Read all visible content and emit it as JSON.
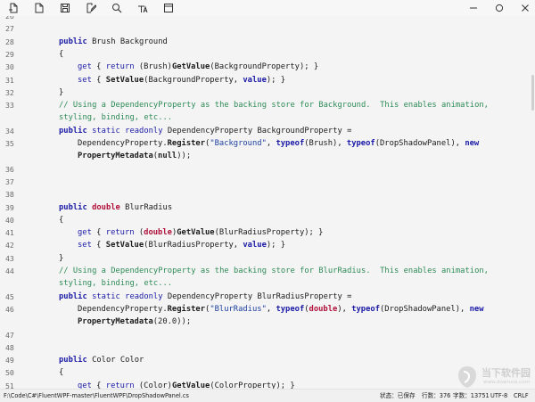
{
  "toolbar": {
    "icons": [
      "new-file-icon",
      "open-file-icon",
      "save-icon",
      "edit-icon",
      "search-icon",
      "format-icon",
      "panel-icon"
    ],
    "window": [
      "minimize-icon",
      "restore-icon",
      "close-icon"
    ]
  },
  "editor": {
    "lines": [
      {
        "n": "26",
        "parts": []
      },
      {
        "n": "27",
        "parts": []
      },
      {
        "n": "28",
        "parts": [
          {
            "c": "kw",
            "t": "public"
          },
          {
            "c": "plain",
            "t": " Brush Background"
          }
        ]
      },
      {
        "n": "29",
        "parts": [
          {
            "c": "plain",
            "t": "{"
          }
        ]
      },
      {
        "n": "30",
        "indent": 1,
        "parts": [
          {
            "c": "kwn",
            "t": "get"
          },
          {
            "c": "plain",
            "t": " { "
          },
          {
            "c": "kwn",
            "t": "return"
          },
          {
            "c": "plain",
            "t": " (Brush)"
          },
          {
            "c": "fn",
            "t": "GetValue"
          },
          {
            "c": "plain",
            "t": "(BackgroundProperty); }"
          }
        ]
      },
      {
        "n": "31",
        "indent": 1,
        "parts": [
          {
            "c": "kwn",
            "t": "set"
          },
          {
            "c": "plain",
            "t": " { "
          },
          {
            "c": "fn",
            "t": "SetValue"
          },
          {
            "c": "plain",
            "t": "(BackgroundProperty, "
          },
          {
            "c": "kw",
            "t": "value"
          },
          {
            "c": "plain",
            "t": "); }"
          }
        ]
      },
      {
        "n": "32",
        "parts": [
          {
            "c": "plain",
            "t": "}"
          }
        ]
      },
      {
        "n": "33",
        "parts": [
          {
            "c": "cmt",
            "t": "// Using a DependencyProperty as the backing store for Background.  This enables animation, styling, binding, etc..."
          }
        ]
      },
      {
        "n": "34",
        "parts": [
          {
            "c": "kw",
            "t": "public"
          },
          {
            "c": "plain",
            "t": " "
          },
          {
            "c": "kwn",
            "t": "static readonly"
          },
          {
            "c": "plain",
            "t": " DependencyProperty BackgroundProperty ="
          }
        ]
      },
      {
        "n": "35",
        "indent": 1,
        "parts": [
          {
            "c": "plain",
            "t": "DependencyProperty."
          },
          {
            "c": "fn",
            "t": "Register"
          },
          {
            "c": "plain",
            "t": "("
          },
          {
            "c": "str",
            "t": "\"Background\""
          },
          {
            "c": "plain",
            "t": ", "
          },
          {
            "c": "kw",
            "t": "typeof"
          },
          {
            "c": "plain",
            "t": "(Brush), "
          },
          {
            "c": "kw",
            "t": "typeof"
          },
          {
            "c": "plain",
            "t": "(DropShadowPanel), "
          },
          {
            "c": "kw",
            "t": "new"
          }
        ]
      },
      {
        "n": "",
        "indent": 1,
        "parts": [
          {
            "c": "fn",
            "t": "PropertyMetadata"
          },
          {
            "c": "plain",
            "t": "("
          },
          {
            "c": "fn",
            "t": "null"
          },
          {
            "c": "plain",
            "t": "));"
          }
        ]
      },
      {
        "n": "36",
        "parts": []
      },
      {
        "n": "37",
        "parts": []
      },
      {
        "n": "38",
        "parts": []
      },
      {
        "n": "39",
        "parts": [
          {
            "c": "kw",
            "t": "public"
          },
          {
            "c": "plain",
            "t": " "
          },
          {
            "c": "kwr",
            "t": "double"
          },
          {
            "c": "plain",
            "t": " BlurRadius"
          }
        ]
      },
      {
        "n": "40",
        "parts": [
          {
            "c": "plain",
            "t": "{"
          }
        ]
      },
      {
        "n": "41",
        "indent": 1,
        "parts": [
          {
            "c": "kwn",
            "t": "get"
          },
          {
            "c": "plain",
            "t": " { "
          },
          {
            "c": "kwn",
            "t": "return"
          },
          {
            "c": "plain",
            "t": " ("
          },
          {
            "c": "kwr",
            "t": "double"
          },
          {
            "c": "plain",
            "t": ")"
          },
          {
            "c": "fn",
            "t": "GetValue"
          },
          {
            "c": "plain",
            "t": "(BlurRadiusProperty); }"
          }
        ]
      },
      {
        "n": "42",
        "indent": 1,
        "parts": [
          {
            "c": "kwn",
            "t": "set"
          },
          {
            "c": "plain",
            "t": " { "
          },
          {
            "c": "fn",
            "t": "SetValue"
          },
          {
            "c": "plain",
            "t": "(BlurRadiusProperty, "
          },
          {
            "c": "kw",
            "t": "value"
          },
          {
            "c": "plain",
            "t": "); }"
          }
        ]
      },
      {
        "n": "43",
        "parts": [
          {
            "c": "plain",
            "t": "}"
          }
        ]
      },
      {
        "n": "44",
        "parts": [
          {
            "c": "cmt",
            "t": "// Using a DependencyProperty as the backing store for BlurRadius.  This enables animation, styling, binding, etc..."
          }
        ]
      },
      {
        "n": "45",
        "parts": [
          {
            "c": "kw",
            "t": "public"
          },
          {
            "c": "plain",
            "t": " "
          },
          {
            "c": "kwn",
            "t": "static readonly"
          },
          {
            "c": "plain",
            "t": " DependencyProperty BlurRadiusProperty ="
          }
        ]
      },
      {
        "n": "46",
        "indent": 1,
        "parts": [
          {
            "c": "plain",
            "t": "DependencyProperty."
          },
          {
            "c": "fn",
            "t": "Register"
          },
          {
            "c": "plain",
            "t": "("
          },
          {
            "c": "str",
            "t": "\"BlurRadius\""
          },
          {
            "c": "plain",
            "t": ", "
          },
          {
            "c": "kw",
            "t": "typeof"
          },
          {
            "c": "plain",
            "t": "("
          },
          {
            "c": "kwr",
            "t": "double"
          },
          {
            "c": "plain",
            "t": "), "
          },
          {
            "c": "kw",
            "t": "typeof"
          },
          {
            "c": "plain",
            "t": "(DropShadowPanel), "
          },
          {
            "c": "kw",
            "t": "new"
          }
        ]
      },
      {
        "n": "",
        "indent": 1,
        "parts": [
          {
            "c": "fn",
            "t": "PropertyMetadata"
          },
          {
            "c": "plain",
            "t": "(20.0));"
          }
        ]
      },
      {
        "n": "47",
        "parts": []
      },
      {
        "n": "48",
        "parts": []
      },
      {
        "n": "49",
        "parts": [
          {
            "c": "kw",
            "t": "public"
          },
          {
            "c": "plain",
            "t": " Color Color"
          }
        ]
      },
      {
        "n": "50",
        "parts": [
          {
            "c": "plain",
            "t": "{"
          }
        ]
      },
      {
        "n": "51",
        "indent": 1,
        "parts": [
          {
            "c": "kwn",
            "t": "get"
          },
          {
            "c": "plain",
            "t": " { "
          },
          {
            "c": "kwn",
            "t": "return"
          },
          {
            "c": "plain",
            "t": " (Color)"
          },
          {
            "c": "fn",
            "t": "GetValue"
          },
          {
            "c": "plain",
            "t": "(ColorProperty); }"
          }
        ]
      }
    ]
  },
  "status": {
    "path": "F:\\Code\\C#\\FluentWPF-master\\FluentWPF\\DropShadowPanel.cs",
    "state": "状态：已保存",
    "lines": "行数：376",
    "chars": "字数：13751",
    "encoding": "UTF-8",
    "line_ending": "CRLF"
  },
  "watermark": {
    "brand": "当下软件园",
    "url": "www.downxia.com"
  },
  "colors": {
    "keyword": "#1a1aa6",
    "keyword_red": "#b0123c",
    "string": "#1d3fa0",
    "comment": "#2e8b57"
  }
}
